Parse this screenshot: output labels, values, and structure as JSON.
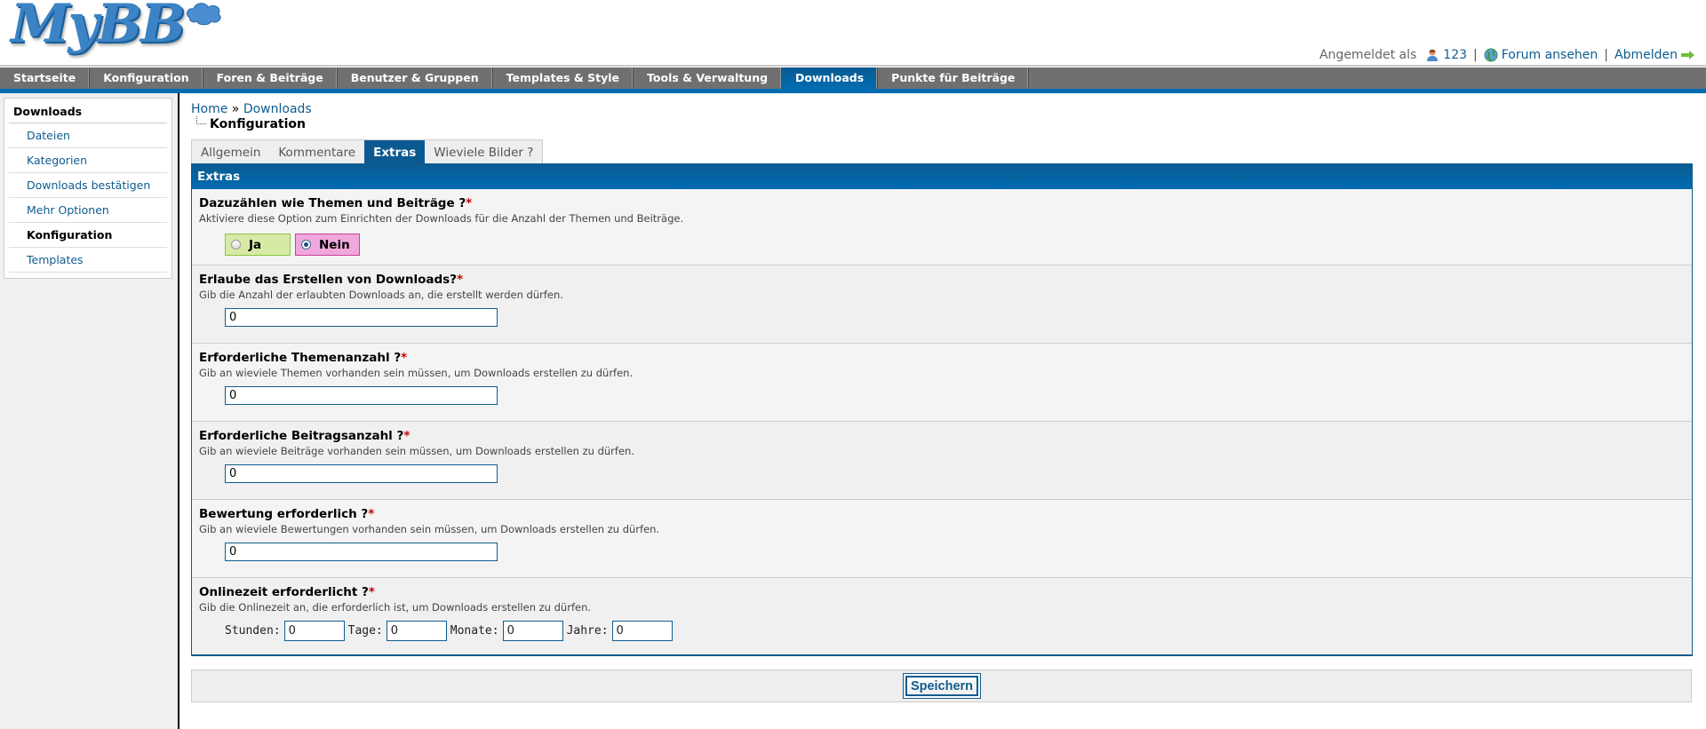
{
  "logo": {
    "text": "MyBB"
  },
  "userbar": {
    "logged_in_as": "Angemeldet als",
    "username": "123",
    "view_forum": "Forum ansehen",
    "logout": "Abmelden",
    "separator": "|"
  },
  "nav": {
    "tabs": [
      {
        "label": "Startseite",
        "active": false
      },
      {
        "label": "Konfiguration",
        "active": false
      },
      {
        "label": "Foren & Beiträge",
        "active": false
      },
      {
        "label": "Benutzer & Gruppen",
        "active": false
      },
      {
        "label": "Templates & Style",
        "active": false
      },
      {
        "label": "Tools & Verwaltung",
        "active": false
      },
      {
        "label": "Downloads",
        "active": true
      },
      {
        "label": "Punkte für Beiträge",
        "active": false
      }
    ]
  },
  "sidebar": {
    "title": "Downloads",
    "items": [
      {
        "label": "Dateien"
      },
      {
        "label": "Kategorien"
      },
      {
        "label": "Downloads bestätigen"
      },
      {
        "label": "Mehr Optionen"
      },
      {
        "label": "Konfiguration",
        "active": true
      },
      {
        "label": "Templates"
      }
    ]
  },
  "breadcrumb": {
    "home": "Home",
    "sep": "»",
    "section": "Downloads",
    "current": "Konfiguration"
  },
  "tabs": [
    {
      "label": "Allgemein"
    },
    {
      "label": "Kommentare"
    },
    {
      "label": "Extras",
      "active": true
    },
    {
      "label": "Wieviele Bilder ?"
    }
  ],
  "panel": {
    "title": "Extras",
    "required_mark": "*",
    "settings": [
      {
        "label": "Dazuzählen wie Themen und Beiträge ?",
        "description": "Aktiviere diese Option zum Einrichten der Downloads für die Anzahl der Themen und Beiträge.",
        "type": "yesno",
        "yes_label": "Ja",
        "no_label": "Nein",
        "value": "Nein"
      },
      {
        "label": "Erlaube das Erstellen von Downloads?",
        "description": "Gib die Anzahl der erlaubten Downloads an, die erstellt werden dürfen.",
        "type": "text",
        "value": "0"
      },
      {
        "label": "Erforderliche Themenanzahl ?",
        "description": "Gib an wieviele Themen vorhanden sein müssen, um Downloads erstellen zu dürfen.",
        "type": "text",
        "value": "0"
      },
      {
        "label": "Erforderliche Beitragsanzahl ?",
        "description": "Gib an wieviele Beiträge vorhanden sein müssen, um Downloads erstellen zu dürfen.",
        "type": "text",
        "value": "0"
      },
      {
        "label": "Bewertung erforderlich ?",
        "description": "Gib an wieviele Bewertungen vorhanden sein müssen, um Downloads erstellen zu dürfen.",
        "type": "text",
        "value": "0"
      },
      {
        "label": "Onlinezeit erforderlicht ?",
        "description": "Gib die Onlinezeit an, die erforderlich ist, um Downloads erstellen zu dürfen.",
        "type": "time",
        "fields": [
          {
            "label": "Stunden:",
            "value": "0"
          },
          {
            "label": "Tage:",
            "value": "0"
          },
          {
            "label": "Monate:",
            "value": "0"
          },
          {
            "label": "Jahre:",
            "value": "0"
          }
        ]
      }
    ]
  },
  "submit": {
    "label": "Speichern"
  },
  "colors": {
    "brand_blue": "#026cb1",
    "nav_gray": "#707070",
    "link": "#0f5c8e",
    "yes_bg": "#d6eaa6",
    "no_bg": "#f0a8dc",
    "required": "#cc0000"
  }
}
